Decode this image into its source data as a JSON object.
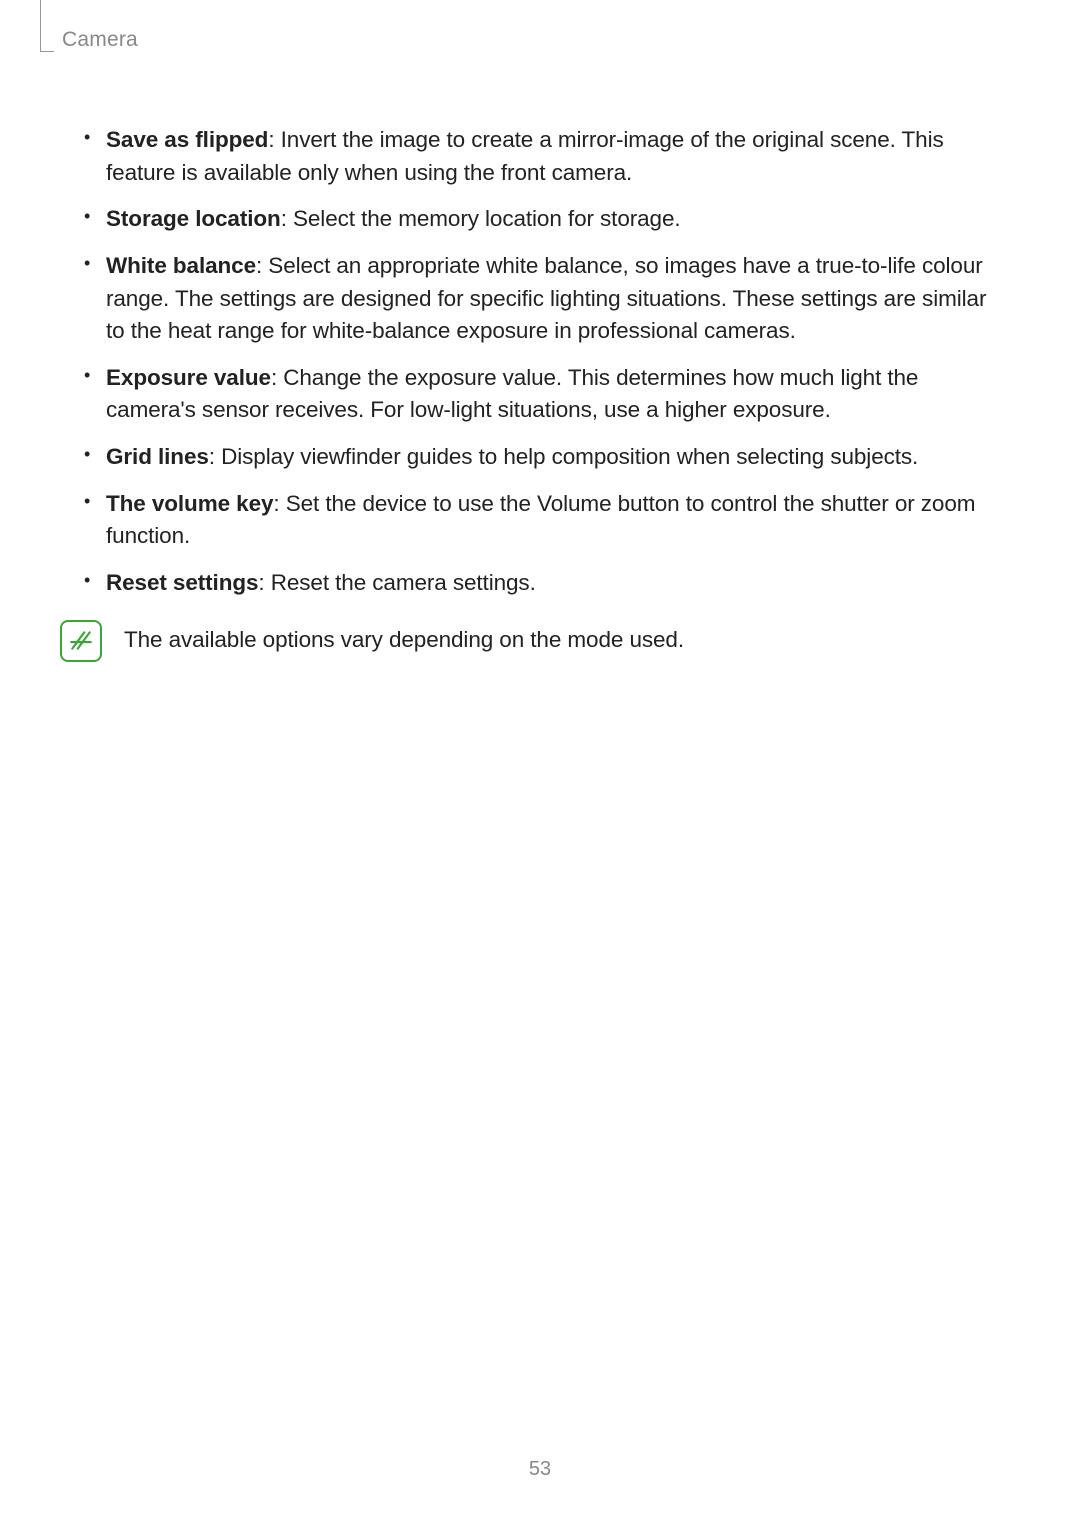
{
  "header": {
    "section": "Camera"
  },
  "items": [
    {
      "term": "Save as flipped",
      "desc": ": Invert the image to create a mirror-image of the original scene. This feature is available only when using the front camera."
    },
    {
      "term": "Storage location",
      "desc": ": Select the memory location for storage."
    },
    {
      "term": "White balance",
      "desc": ": Select an appropriate white balance, so images have a true-to-life colour range. The settings are designed for specific lighting situations. These settings are similar to the heat range for white-balance exposure in professional cameras."
    },
    {
      "term": "Exposure value",
      "desc": ": Change the exposure value. This determines how much light the camera's sensor receives. For low-light situations, use a higher exposure."
    },
    {
      "term": "Grid lines",
      "desc": ": Display viewfinder guides to help composition when selecting subjects."
    },
    {
      "term": "The volume key",
      "desc": ": Set the device to use the Volume button to control the shutter or zoom function."
    },
    {
      "term": "Reset settings",
      "desc": ": Reset the camera settings."
    }
  ],
  "note": {
    "text": "The available options vary depending on the mode used."
  },
  "page_number": "53"
}
